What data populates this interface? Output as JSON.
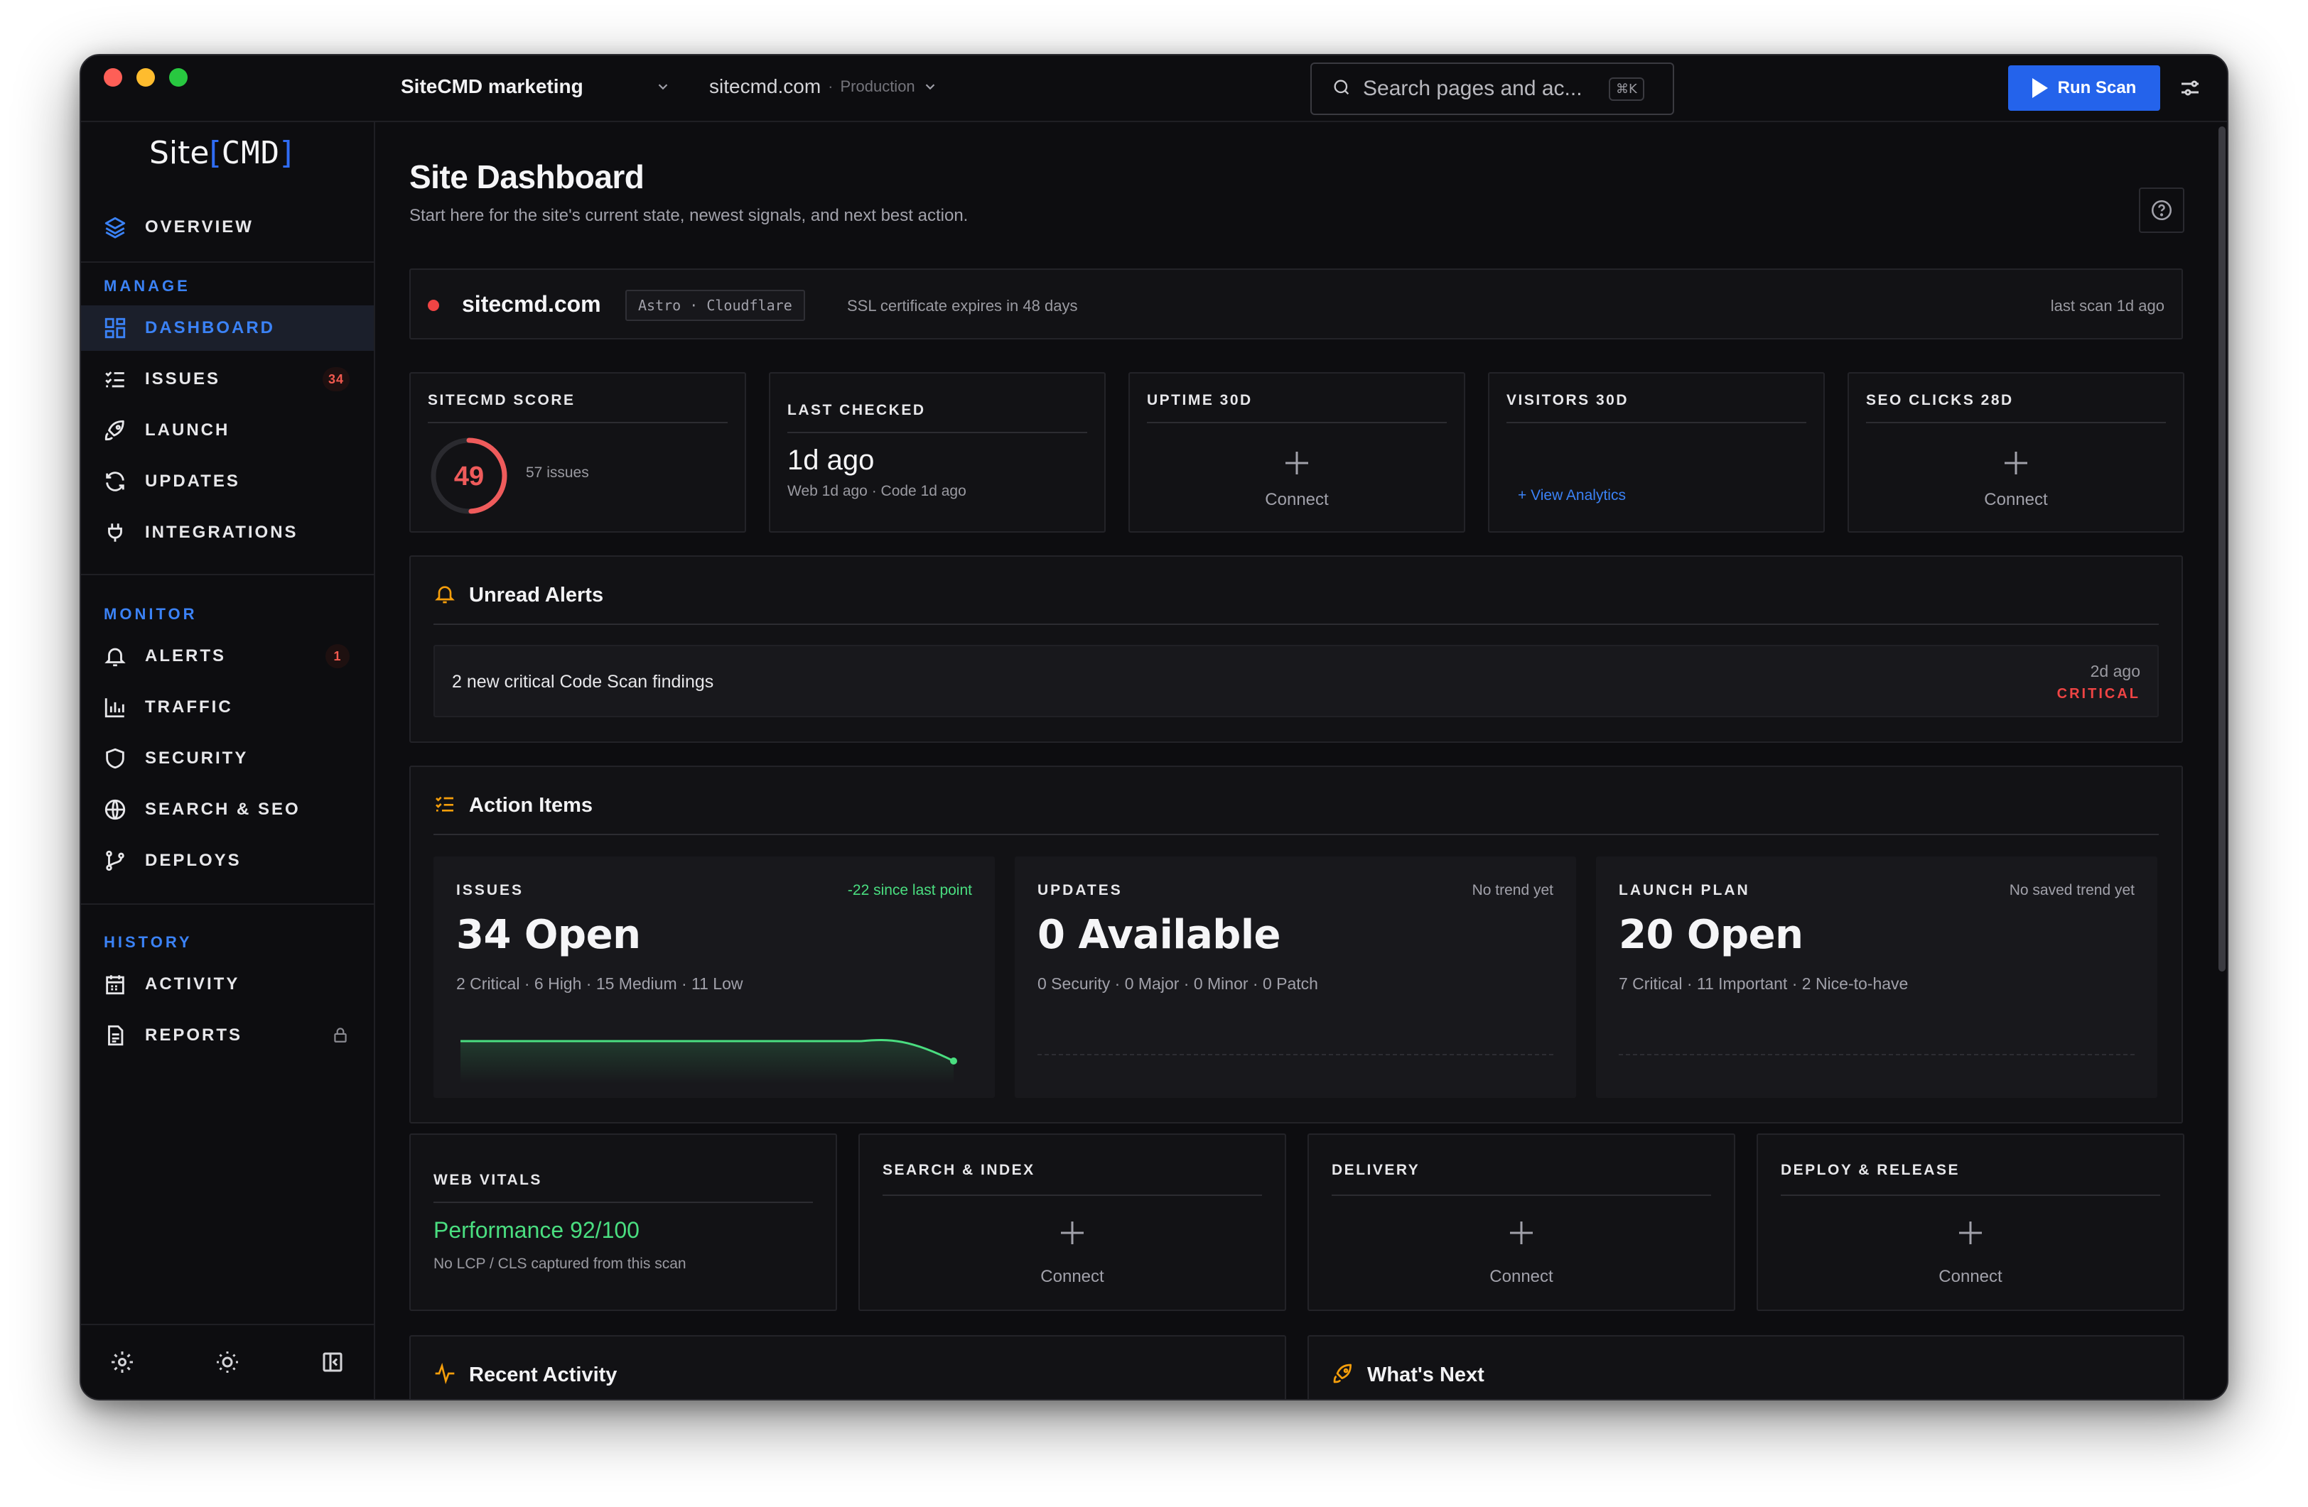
{
  "topbar": {
    "project": "SiteCMD marketing",
    "domain": "sitecmd.com",
    "env_separator": "·",
    "environment": "Production",
    "search_placeholder": "Search pages and ac...",
    "search_shortcut": "⌘K",
    "run_scan_label": "Run Scan"
  },
  "logo": {
    "text": "Site",
    "bracket_open": "[",
    "cmd": "CMD",
    "bracket_close": "]"
  },
  "sidebar": {
    "overview": "OVERVIEW",
    "sections": {
      "manage": "MANAGE",
      "monitor": "MONITOR",
      "history": "HISTORY"
    },
    "manage_items": [
      {
        "label": "DASHBOARD",
        "icon": "grid-icon",
        "active": true
      },
      {
        "label": "ISSUES",
        "icon": "checklist-icon",
        "badge": "34"
      },
      {
        "label": "LAUNCH",
        "icon": "rocket-icon"
      },
      {
        "label": "UPDATES",
        "icon": "refresh-icon"
      },
      {
        "label": "INTEGRATIONS",
        "icon": "plug-icon"
      }
    ],
    "monitor_items": [
      {
        "label": "ALERTS",
        "icon": "bell-icon",
        "badge": "1"
      },
      {
        "label": "TRAFFIC",
        "icon": "bar-chart-icon"
      },
      {
        "label": "SECURITY",
        "icon": "shield-icon"
      },
      {
        "label": "SEARCH & SEO",
        "icon": "globe-icon"
      },
      {
        "label": "DEPLOYS",
        "icon": "git-branch-icon"
      }
    ],
    "history_items": [
      {
        "label": "ACTIVITY",
        "icon": "calendar-icon"
      },
      {
        "label": "REPORTS",
        "icon": "document-icon",
        "locked": true
      }
    ]
  },
  "page": {
    "title": "Site Dashboard",
    "subtitle": "Start here for the site's current state, newest signals, and next best action."
  },
  "site": {
    "name": "sitecmd.com",
    "stack": "Astro · Cloudflare",
    "ssl": "SSL certificate expires in 48 days",
    "last_scan": "last scan 1d ago",
    "status_color": "#ef4444"
  },
  "stats": {
    "score": {
      "label": "SITECMD SCORE",
      "value": "49",
      "score_fraction": 0.49,
      "issues": "57 issues"
    },
    "last_checked": {
      "label": "LAST CHECKED",
      "value": "1d ago",
      "detail": "Web 1d ago · Code 1d ago"
    },
    "uptime": {
      "label": "UPTIME 30D",
      "action": "Connect"
    },
    "visitors": {
      "label": "VISITORS 30D",
      "link": "+ View Analytics"
    },
    "seo": {
      "label": "SEO CLICKS 28D",
      "action": "Connect"
    }
  },
  "alerts": {
    "title": "Unread Alerts",
    "items": [
      {
        "text": "2 new critical Code Scan findings",
        "time": "2d ago",
        "severity": "CRITICAL"
      }
    ]
  },
  "action_items": {
    "title": "Action Items",
    "tiles": [
      {
        "label": "ISSUES",
        "trend": "-22 since last point",
        "value": "34 Open",
        "breakdown": "2 Critical · 6 High · 15 Medium · 11 Low"
      },
      {
        "label": "UPDATES",
        "trend": "No trend yet",
        "value": "0 Available",
        "breakdown": "0 Security · 0 Major · 0 Minor · 0 Patch"
      },
      {
        "label": "LAUNCH PLAN",
        "trend": "No saved trend yet",
        "value": "20 Open",
        "breakdown": "7 Critical · 11 Important · 2 Nice-to-have"
      }
    ]
  },
  "lower_cards": {
    "web_vitals": {
      "label": "WEB VITALS",
      "value": "Performance 92/100",
      "note": "No LCP / CLS captured from this scan"
    },
    "search_index": {
      "label": "SEARCH & INDEX",
      "action": "Connect"
    },
    "delivery": {
      "label": "DELIVERY",
      "action": "Connect"
    },
    "deploy_release": {
      "label": "DEPLOY & RELEASE",
      "action": "Connect"
    }
  },
  "bottom": {
    "recent_activity": "Recent Activity",
    "whats_next": "What's Next"
  },
  "colors": {
    "accent": "#2463eb",
    "critical": "#ef4444",
    "positive": "#4ade80",
    "warning": "#f59e0b"
  }
}
